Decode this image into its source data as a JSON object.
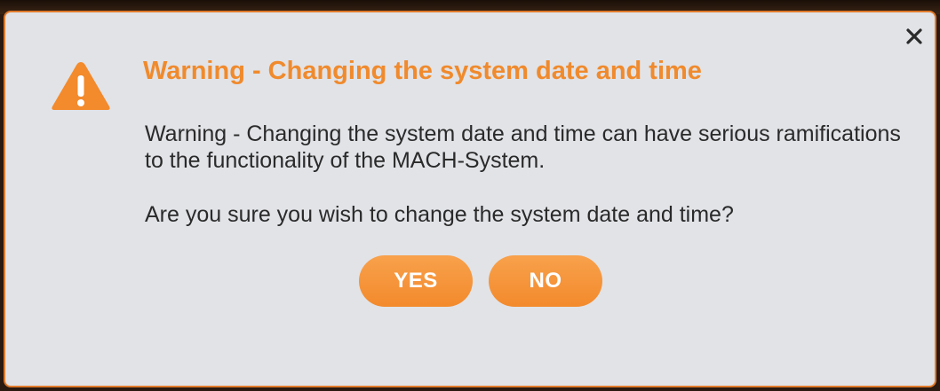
{
  "dialog": {
    "title": "Warning - Changing the system date and time",
    "message": "Warning - Changing the system date and time can have serious ramifications to the functionality of the MACH-System.",
    "question": "Are you sure you wish to change the system date and time?",
    "yes_label": "YES",
    "no_label": "NO",
    "close_label": "×",
    "icon": "warning-icon"
  },
  "colors": {
    "accent": "#f38a2c",
    "background": "#e1e3e7",
    "text": "#2a2a2a"
  }
}
